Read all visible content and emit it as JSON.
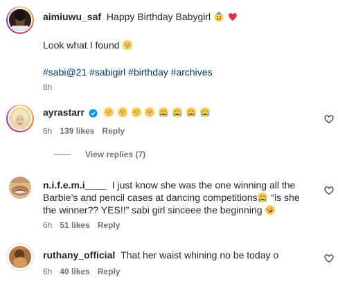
{
  "caption": {
    "username": "aimiuwu_saf",
    "text": "Happy Birthday Babygirl",
    "line2": "Look what I found",
    "hashtags": "#sabi@21 #sabigirl #birthday #archives",
    "time": "8h"
  },
  "comments": [
    {
      "username": "ayrastarr",
      "verified": true,
      "time": "6h",
      "likes": "139 likes",
      "reply": "Reply"
    },
    {
      "username": "n.i.f.e.m.i____",
      "line1": "I just know she was the one winning all the",
      "line2": "Barbie’s and pencil cases at dancing competitions",
      "line2b": "“is she",
      "line3": "the winner?? YES!!” sabi girl sinceee the beginning",
      "time": "6h",
      "likes": "51 likes",
      "reply": "Reply"
    },
    {
      "username": "ruthany_official",
      "text": "That her waist whining no be today o",
      "time": "6h",
      "likes": "40 likes",
      "reply": "Reply"
    }
  ],
  "view_replies": "View replies (7)",
  "colors": {
    "hashtag": "#00376b",
    "muted": "#737373",
    "verified": "#0095f6",
    "heart_red": "#ed4956",
    "ring_gradient": [
      "#feda75",
      "#fa7e1e",
      "#d62976",
      "#962fbf"
    ]
  }
}
